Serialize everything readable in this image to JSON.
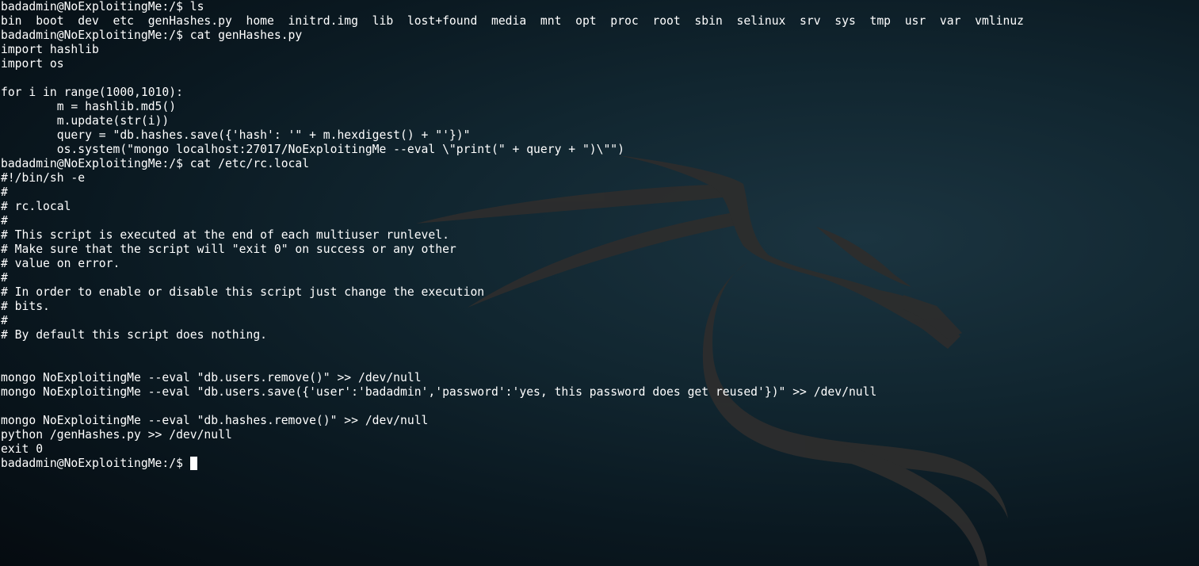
{
  "terminal": {
    "lines": [
      "badadmin@NoExploitingMe:/$ ls",
      "bin  boot  dev  etc  genHashes.py  home  initrd.img  lib  lost+found  media  mnt  opt  proc  root  sbin  selinux  srv  sys  tmp  usr  var  vmlinuz",
      "badadmin@NoExploitingMe:/$ cat genHashes.py",
      "import hashlib",
      "import os",
      "",
      "for i in range(1000,1010):",
      "        m = hashlib.md5()",
      "        m.update(str(i))",
      "        query = \"db.hashes.save({'hash': '\" + m.hexdigest() + \"'})\"",
      "        os.system(\"mongo localhost:27017/NoExploitingMe --eval \\\"print(\" + query + \")\\\"\")",
      "badadmin@NoExploitingMe:/$ cat /etc/rc.local",
      "#!/bin/sh -e",
      "#",
      "# rc.local",
      "#",
      "# This script is executed at the end of each multiuser runlevel.",
      "# Make sure that the script will \"exit 0\" on success or any other",
      "# value on error.",
      "#",
      "# In order to enable or disable this script just change the execution",
      "# bits.",
      "#",
      "# By default this script does nothing.",
      "",
      "",
      "mongo NoExploitingMe --eval \"db.users.remove()\" >> /dev/null",
      "mongo NoExploitingMe --eval \"db.users.save({'user':'badadmin','password':'yes, this password does get reused'})\" >> /dev/null",
      "",
      "mongo NoExploitingMe --eval \"db.hashes.remove()\" >> /dev/null",
      "python /genHashes.py >> /dev/null",
      "exit 0"
    ],
    "prompt": "badadmin@NoExploitingMe:/$ "
  },
  "background": {
    "type": "kali-dragon-wallpaper",
    "colors": {
      "base": "#0a1820",
      "highlight": "#1b3440",
      "dragon": "#2e2e2e",
      "text": "#ffffff"
    }
  }
}
